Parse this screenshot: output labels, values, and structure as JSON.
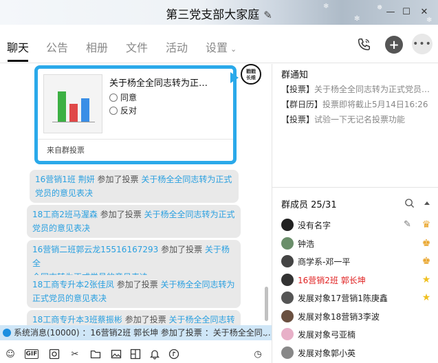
{
  "window": {
    "title": "第三党支部大家庭",
    "edit_glyph": "✎",
    "controls": {
      "minimize": "—",
      "maximize": "☐",
      "close": "✕"
    }
  },
  "tabs": [
    {
      "label": "聊天",
      "active": true
    },
    {
      "label": "公告"
    },
    {
      "label": "相册"
    },
    {
      "label": "文件"
    },
    {
      "label": "活动"
    },
    {
      "label": "设置",
      "chevron": "⌄"
    }
  ],
  "header_icons": {
    "call": "phone-icon",
    "add": "+",
    "more": "•••"
  },
  "vote_card": {
    "title": "关于杨全全同志转为正…",
    "options": [
      "同意",
      "反对"
    ],
    "source": "来自群投票",
    "badge_text": [
      "戳戳",
      "长维"
    ],
    "bar_colors": [
      "#3cb043",
      "#e04848",
      "#3a8ee6"
    ]
  },
  "messages": [
    {
      "sender": "16营销1班 荆妍",
      "action": " 参加了投票 ",
      "link1": "关于杨全全同志转为正式",
      "link2": "党员的意见表决"
    },
    {
      "sender": "18工商2班马渥森",
      "action": " 参加了投票 ",
      "link1": "关于杨全全同志转为正式",
      "link2": "党员的意见表决"
    },
    {
      "sender": "16营销二班郭云龙15516167293",
      "action": " 参加了投票 ",
      "link1": "关于杨全",
      "link2": "全同志转为正式党员的意见表决"
    },
    {
      "sender": "18工商专升本2张佳凤",
      "action": " 参加了投票 ",
      "link1": "关于杨全全同志转为",
      "link2": "正式党员的意见表决"
    },
    {
      "sender": "18工商专升本3班蔡振彬",
      "action": " 参加了投票 ",
      "link1": "关于杨全全同志转",
      "link2": ""
    }
  ],
  "system_message": "系统消息(10000) ：16营销2班 郭长坤 参加了投票 ：关于杨全全同…",
  "system_more": "⌄",
  "toolbar_icons": [
    "smile-icon",
    "gif-icon",
    "screenshot-icon",
    "scissors-icon",
    "folder-icon",
    "image-icon",
    "collage-icon",
    "bell-icon",
    "music-icon",
    "history-icon"
  ],
  "toolbar_glyphs": {
    "gif": "GIF",
    "smile": "☺",
    "scissors": "✂",
    "history": "◷"
  },
  "notices": {
    "title": "群通知",
    "items": [
      {
        "tag": "【投票】",
        "text": "关于杨全全同志转为正式党员…"
      },
      {
        "tag": "【群日历】",
        "text": "投票即将截止5月14日16:26"
      },
      {
        "tag": "【投票】",
        "text": "试验一下无记名投票功能"
      }
    ]
  },
  "members": {
    "title": "群成员 25/31",
    "list": [
      {
        "name": "没有名字",
        "role": "owner",
        "avatar_color": "#222",
        "red": false,
        "editable": true
      },
      {
        "name": "钟浩",
        "role": "admin",
        "avatar_color": "#6a8e6a",
        "red": false
      },
      {
        "name": "商学系-邓一平",
        "role": "admin",
        "avatar_color": "#444",
        "red": false
      },
      {
        "name": "16营销2班 郭长坤",
        "role": "star",
        "avatar_color": "#333",
        "red": true
      },
      {
        "name": "发展对象17营销1陈庚鑫",
        "role": "star",
        "avatar_color": "#555",
        "red": false
      },
      {
        "name": "发展对象18营销3李波",
        "role": "",
        "avatar_color": "#6a5040",
        "red": false
      },
      {
        "name": "发展对象弓亚楠",
        "role": "",
        "avatar_color": "#e8b0c8",
        "red": false
      },
      {
        "name": "发展对象郭小英",
        "role": "",
        "avatar_color": "#888",
        "red": false
      }
    ]
  }
}
